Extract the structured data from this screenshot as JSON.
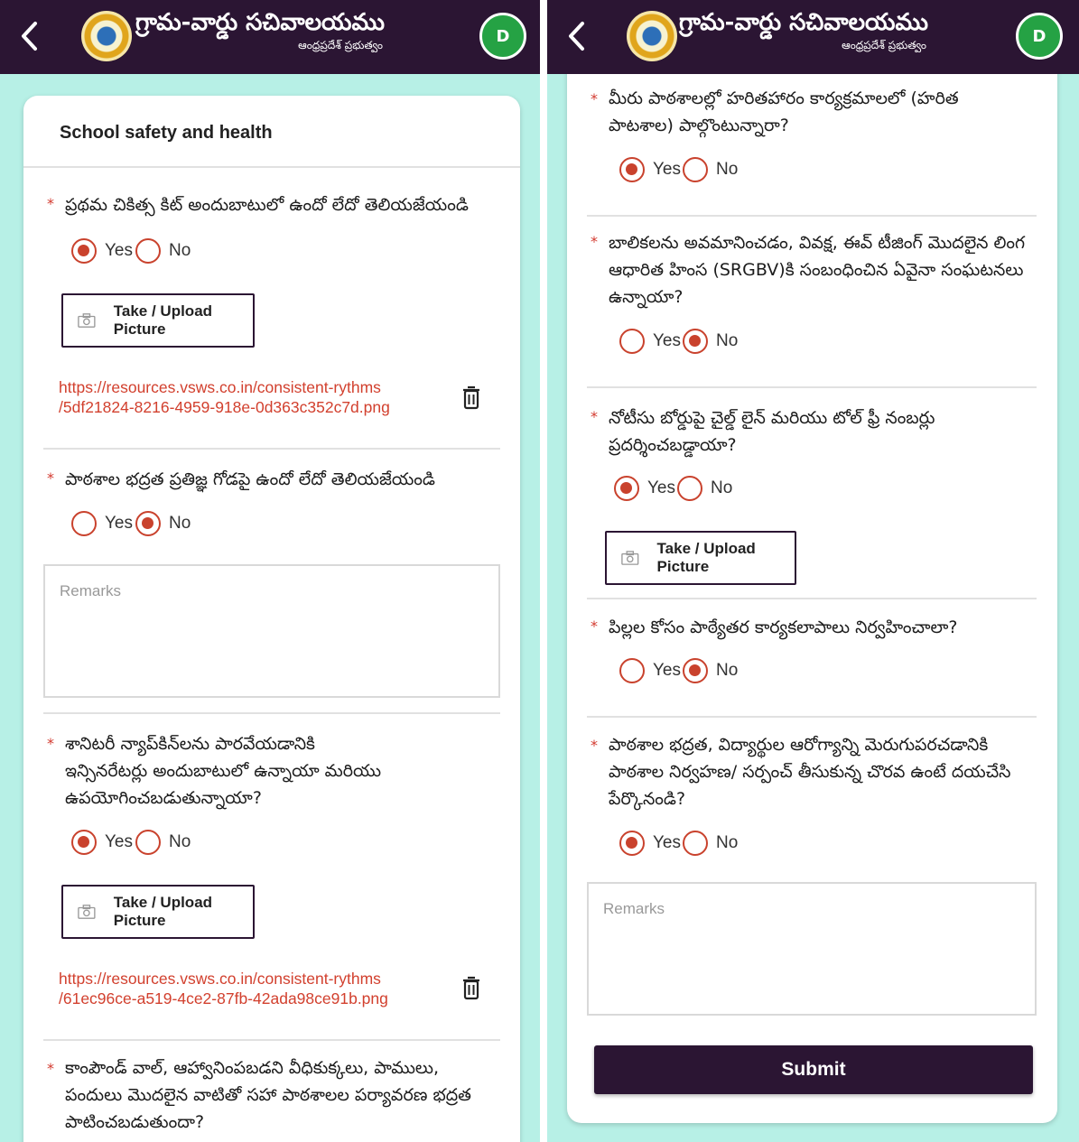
{
  "header": {
    "title": "గ్రామ-వార్డు సచివాలయము",
    "subtitle": "ఆంధ్రప్రదేశ్ ప్రభుత్వం",
    "avatar_letter": "D",
    "icons": {
      "back": "back-chevron-icon",
      "logo": "ap-government-emblem",
      "upload": "camera-icon",
      "delete": "trash-icon"
    },
    "colors": {
      "appbar": "#2b1533",
      "background": "#b7f0e6",
      "avatar": "#25a244",
      "accent": "#c9422d",
      "link": "#d2402e"
    }
  },
  "common": {
    "yes": "Yes",
    "no": "No",
    "upload_label": "Take / Upload Picture",
    "remarks_placeholder": "Remarks",
    "required_mark": "*",
    "submit_label": "Submit"
  },
  "left": {
    "section_title": "School safety and health",
    "questions": [
      {
        "text": "ప్రథమ చికిత్స కిట్ అందుబాటులో ఉందో లేదో తెలియజేయండి",
        "answer": "Yes",
        "link": [
          "https://resources.vsws.co.in/consistent-rythms",
          "/5df21824-8216-4959-918e-0d363c352c7d.png"
        ]
      },
      {
        "text": "పాఠశాల భద్రత ప్రతిజ్ఞ గోడపై ఉందో లేదో తెలియజేయండి",
        "answer": "No"
      },
      {
        "lines": [
          "శానిటరీ న్యాప్‌కిన్‌లను పారవేయడానికి",
          "ఇన్సినరేటర్లు అందుబాటులో ఉన్నాయా మరియు",
          "ఉపయోగించబడుతున్నాయా?"
        ],
        "answer": "Yes",
        "link": [
          "https://resources.vsws.co.in/consistent-rythms",
          "/61ec96ce-a519-4ce2-87fb-42ada98ce91b.png"
        ]
      },
      {
        "lines": [
          "కాంపౌండ్ వాల్, ఆహ్వానింపబడని వీధికుక్కలు, పాములు,",
          "పందులు మొదలైన వాటితో సహా పాఠశాలల పర్యావరణ భద్రత",
          "పాటించబడుతుందా?"
        ]
      }
    ]
  },
  "right": {
    "questions": [
      {
        "lines": [
          "మీరు పాఠశాలల్లో హరితహారం కార్యక్రమాలలో (హరిత",
          "పాటశాల) పాల్గొంటున్నారా?"
        ],
        "answer": "Yes"
      },
      {
        "lines": [
          "బాలికలను అవమానించడం, వివక్ష, ఈవ్ టీజింగ్ మొదలైన లింగ",
          "ఆధారిత హింస (SRGBV)కి సంబంధించిన ఏవైనా సంఘటనలు",
          "ఉన్నాయా?"
        ],
        "answer": "No"
      },
      {
        "lines": [
          "నోటీసు బోర్డుపై చైల్డ్ లైన్ మరియు టోల్ ఫ్రీ నంబర్లు",
          "ప్రదర్శించబడ్డాయా?"
        ],
        "answer": "Yes"
      },
      {
        "text": "పిల్లల కోసం పాఠ్యేతర కార్యకలాపాలు నిర్వహించాలా?",
        "answer": "No"
      },
      {
        "lines": [
          "పాఠశాల భద్రత, విద్యార్థుల ఆరోగ్యాన్ని మెరుగుపరచడానికి",
          "పాఠశాల నిర్వహణ/ సర్పంచ్ తీసుకున్న చొరవ ఉంటే దయచేసి",
          "పేర్కొనండి?"
        ],
        "answer": "Yes"
      }
    ]
  }
}
